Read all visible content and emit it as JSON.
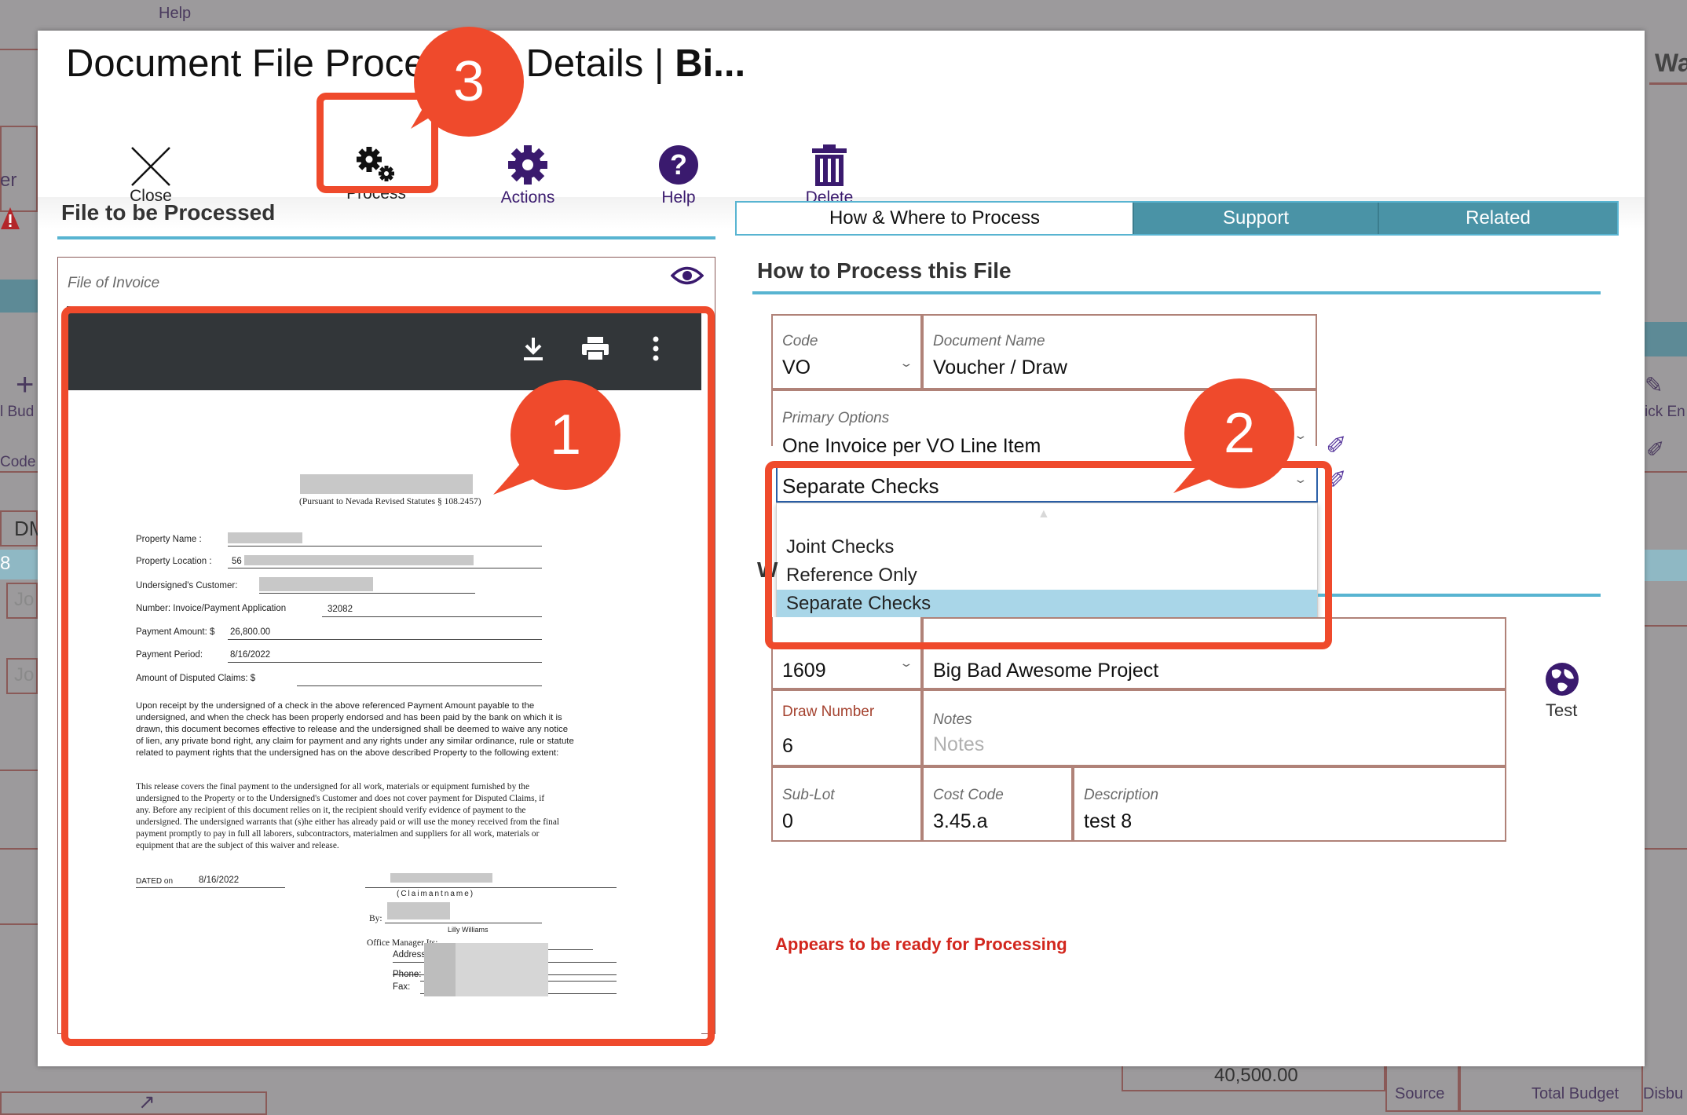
{
  "background": {
    "help_label": "Help",
    "right_header": "Wa",
    "left_labels": [
      "er",
      "l Bud",
      "Code",
      "DM",
      "8",
      "Jo",
      "Jo"
    ],
    "right_labels": [
      "ick En"
    ],
    "amount": "40,500.00",
    "bottom_cols": [
      "Source",
      "Total Budget",
      "Disbu"
    ]
  },
  "modal": {
    "title_prefix": "Document File Proce",
    "title_mid": "Details |",
    "title_bold": "Bi..."
  },
  "toolbar": {
    "close": "Close",
    "process": "Process",
    "actions": "Actions",
    "help": "Help",
    "delete": "Delete"
  },
  "left": {
    "section_title": "File to be Processed",
    "card_label": "File of Invoice"
  },
  "document": {
    "statute": "(Pursuant to Nevada Revised Statutes § 108.2457)",
    "property_name_label": "Property Name :",
    "property_location_label": "Property Location :",
    "property_location_value": "56",
    "customer_label": "Undersigned's Customer:",
    "number_label": "Number:  Invoice/Payment Application",
    "number_value": "32082",
    "payment_amount_label": "Payment Amount: $",
    "payment_amount_value": "26,800.00",
    "payment_period_label": "Payment Period:",
    "payment_period_value": "8/16/2022",
    "disputed_label": "Amount of Disputed Claims: $",
    "para1": "Upon receipt by the undersigned of a check in the above referenced Payment Amount payable to the undersigned, and when the check has been properly endorsed and has been paid by the bank on which it is drawn, this document becomes effective to release and the undersigned shall be deemed to waive any notice of lien, any private bond right, any claim for payment and any rights under any similar ordinance, rule or statute related to payment rights that the undersigned has on the above described Property to the following extent:",
    "para2": "This release covers the final payment to the undersigned for all work, materials or equipment furnished by the undersigned to the Property or to the Undersigned's Customer and does not cover payment for Disputed Claims, if any. Before any recipient of this document relies on it, the recipient should verify evidence of payment to the undersigned. The undersigned warrants that (s)he either has already paid or will use the money received from the final payment promptly to pay in full all laborers, subcontractors, materialmen and suppliers for all work, materials or equipment that are the subject of this waiver and release.",
    "dated_label": "DATED on",
    "dated_value": "8/16/2022",
    "claimant_label": "(Claimantname)",
    "by_label": "By:",
    "signer": "Lilly Williams",
    "office_label": "Office Manager Its:",
    "address_label": "Address",
    "phone_label": "Phone:",
    "fax_label": "Fax:"
  },
  "tabs": [
    {
      "label": "How & Where to Process"
    },
    {
      "label": "Support"
    },
    {
      "label": "Related"
    }
  ],
  "process": {
    "section_title": "How to Process this File",
    "code_label": "Code",
    "code_value": "VO",
    "docname_label": "Document Name",
    "docname_value": "Voucher / Draw",
    "primary_label": "Primary Options",
    "primary_value": "One Invoice per VO Line Item",
    "secondary_value": "Separate Checks",
    "dropdown_options": [
      "Joint Checks",
      "Reference Only",
      "Separate Checks"
    ],
    "where_letter": "W",
    "project_value": "1609",
    "project_name": "Big Bad Awesome Project",
    "test_label": "Test",
    "draw_label": "Draw Number",
    "draw_value": "6",
    "notes_label": "Notes",
    "notes_placeholder": "Notes",
    "sublot_label": "Sub-Lot",
    "sublot_value": "0",
    "costcode_label": "Cost Code",
    "costcode_value": "3.45.a",
    "desc_label": "Description",
    "desc_value": "test 8",
    "status": "Appears to be ready for Processing"
  },
  "callouts": [
    "1",
    "2",
    "3"
  ],
  "colors": {
    "accent": "#58b4d1",
    "tab_inactive": "#4a93a6",
    "callout": "#ef4a2c",
    "icon_purple": "#3a1a6e",
    "status_red": "#d2261d"
  }
}
